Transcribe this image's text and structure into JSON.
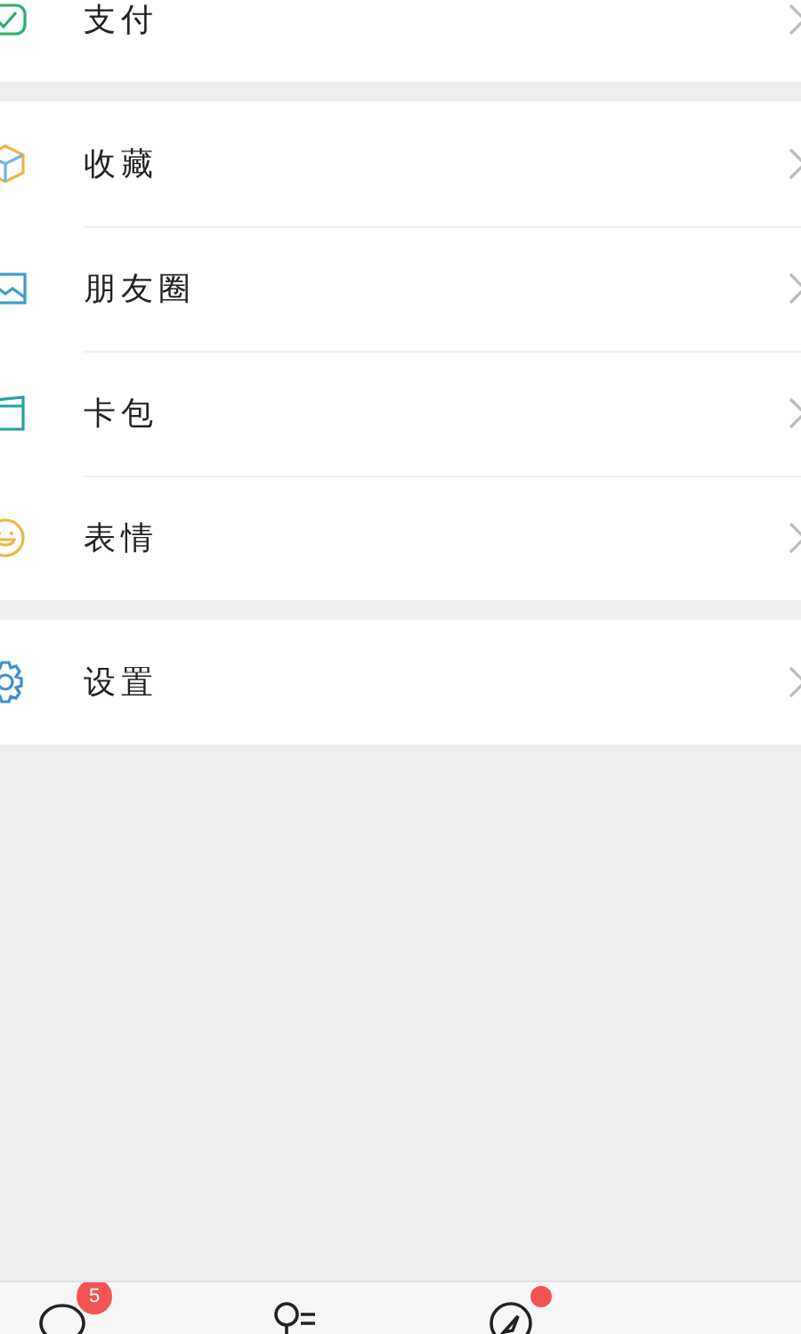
{
  "sections": [
    {
      "items": [
        {
          "kind": "pay",
          "label": "支付"
        }
      ]
    },
    {
      "items": [
        {
          "kind": "favorites",
          "label": "收藏"
        },
        {
          "kind": "moments",
          "label": "朋友圈"
        },
        {
          "kind": "cards",
          "label": "卡包"
        },
        {
          "kind": "stickers",
          "label": "表情"
        }
      ]
    },
    {
      "items": [
        {
          "kind": "settings",
          "label": "设置"
        }
      ]
    }
  ],
  "tab_bar": [
    {
      "kind": "chats",
      "badge": "5",
      "dot": false
    },
    {
      "kind": "contacts",
      "dot": false
    },
    {
      "kind": "discover",
      "dot": true
    }
  ]
}
